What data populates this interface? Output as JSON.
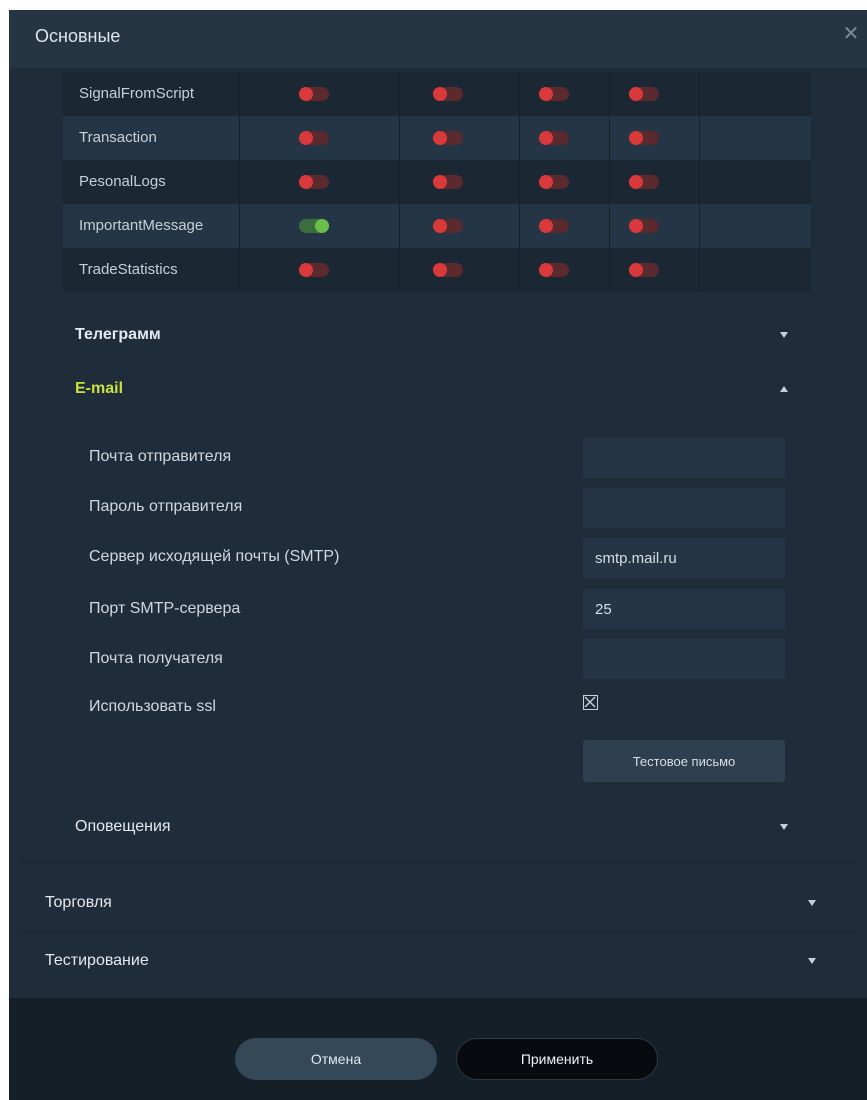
{
  "dialog": {
    "title": "Основные",
    "close_icon": "close-icon"
  },
  "notifications_table": {
    "rows": [
      {
        "name": "SignalFromScript",
        "toggles": [
          false,
          false,
          false,
          false
        ]
      },
      {
        "name": "Transaction",
        "toggles": [
          false,
          false,
          false,
          false
        ]
      },
      {
        "name": "PesonalLogs",
        "toggles": [
          false,
          false,
          false,
          false
        ]
      },
      {
        "name": "ImportantMessage",
        "toggles": [
          true,
          false,
          false,
          false
        ]
      },
      {
        "name": "TradeStatistics",
        "toggles": [
          false,
          false,
          false,
          false
        ]
      }
    ]
  },
  "sections": {
    "telegram": {
      "label": "Телеграмм",
      "expanded": false
    },
    "email": {
      "label": "E-mail",
      "expanded": true
    },
    "alerts": {
      "label": "Оповещения",
      "expanded": false
    },
    "trading": {
      "label": "Торговля",
      "expanded": false
    },
    "testing": {
      "label": "Тестирование",
      "expanded": false
    }
  },
  "email_form": {
    "sender_email": {
      "label": "Почта отправителя",
      "value": ""
    },
    "sender_password": {
      "label": "Пароль отправителя",
      "value": ""
    },
    "smtp_server": {
      "label": "Сервер исходящей почты (SMTP)",
      "value": "smtp.mail.ru"
    },
    "smtp_port": {
      "label": "Порт SMTP-сервера",
      "value": "25"
    },
    "recipient_email": {
      "label": "Почта получателя",
      "value": ""
    },
    "use_ssl": {
      "label": "Использовать ssl",
      "checked": true
    },
    "test_button": "Тестовое письмо"
  },
  "footer": {
    "cancel": "Отмена",
    "apply": "Применить"
  },
  "colors": {
    "background": "#1f2d3a",
    "accent": "#c9e13a",
    "toggle_on": "#6abf4b",
    "toggle_off": "#d9393b"
  }
}
